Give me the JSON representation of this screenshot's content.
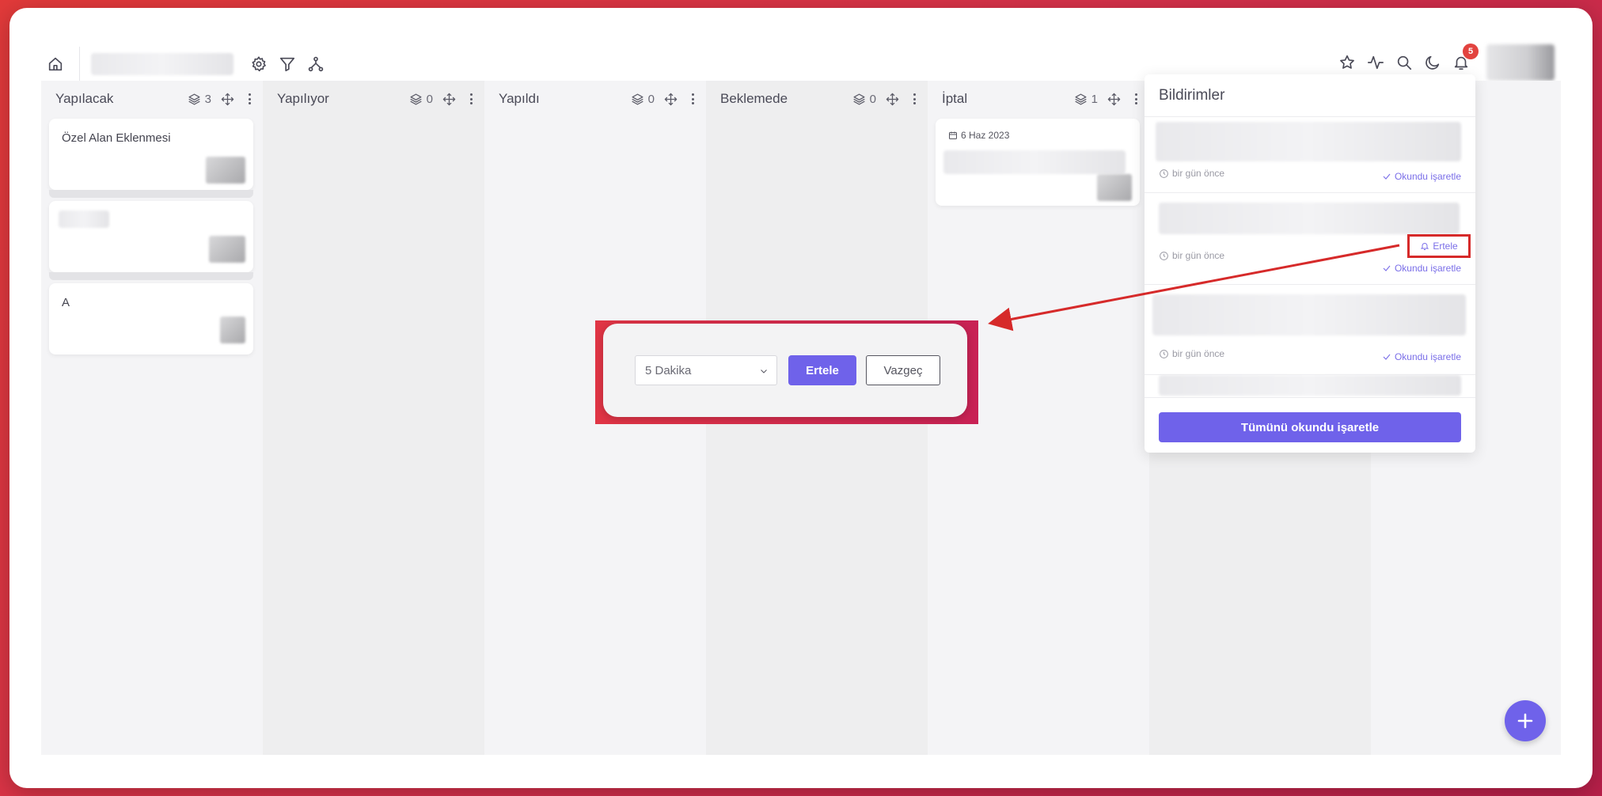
{
  "topbar": {
    "icons_left": [
      "home-icon",
      "settings-icon",
      "filter-icon",
      "hierarchy-icon"
    ],
    "icons_right": [
      "star-icon",
      "activity-icon",
      "search-icon",
      "moon-icon",
      "bell-icon"
    ],
    "notification_count": "5"
  },
  "columns": [
    {
      "title": "Yapılacak",
      "count": "3"
    },
    {
      "title": "Yapılıyor",
      "count": "0"
    },
    {
      "title": "Yapıldı",
      "count": "0"
    },
    {
      "title": "Beklemede",
      "count": "0"
    },
    {
      "title": "İptal",
      "count": "1"
    }
  ],
  "cards": {
    "todo": [
      {
        "title": "Özel Alan Eklenmesi"
      },
      {
        "title": ""
      },
      {
        "title": "A"
      }
    ],
    "cancelled": [
      {
        "date": "6 Haz 2023"
      }
    ]
  },
  "notifications": {
    "title": "Bildirimler",
    "items": [
      {
        "time": "bir gün önce",
        "mark_read": "Okundu işaretle"
      },
      {
        "time": "bir gün önce",
        "mark_read": "Okundu işaretle",
        "snooze": "Ertele"
      },
      {
        "time": "bir gün önce",
        "mark_read": "Okundu işaretle"
      }
    ],
    "mark_all_read": "Tümünü okundu işaretle"
  },
  "snooze_dialog": {
    "selected_option": "5 Dakika",
    "confirm_label": "Ertele",
    "cancel_label": "Vazgeç"
  },
  "colors": {
    "accent": "#6f62ea",
    "badge": "#e2433f",
    "highlight": "#d62a2a"
  }
}
